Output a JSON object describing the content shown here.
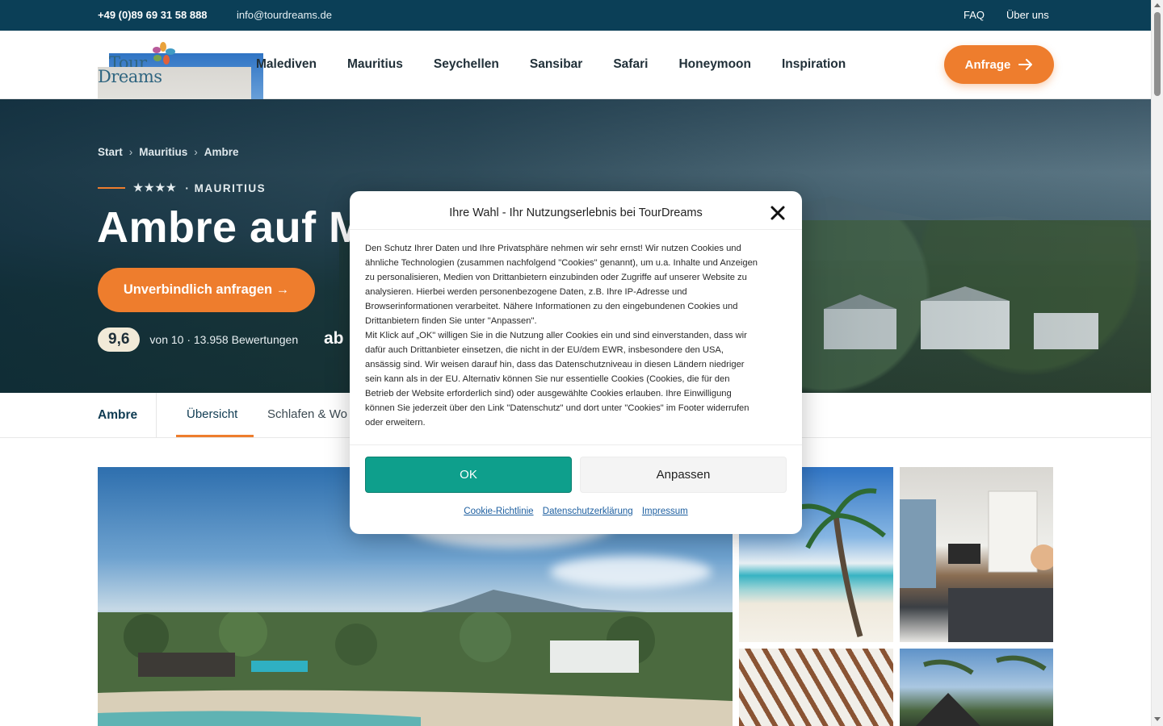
{
  "topbar": {
    "phone": "+49 (0)89 69 31 58 888",
    "email": "info@tourdreams.de",
    "faq": "FAQ",
    "about": "Über uns"
  },
  "logo": {
    "line1": "Tour",
    "line2": "Dreams"
  },
  "nav": {
    "items": [
      "Malediven",
      "Mauritius",
      "Seychellen",
      "Sansibar",
      "Safari",
      "Honeymoon",
      "Inspiration"
    ],
    "cta": "Anfrage"
  },
  "breadcrumb": [
    "Start",
    "Mauritius",
    "Ambre"
  ],
  "hero": {
    "eyebrow_stars": "★★★★",
    "eyebrow_country": "· MAURITIUS",
    "title": "Ambre auf M",
    "cta": "Unverbindlich anfragen →",
    "score": "9,6",
    "reviews": "von 10 · 13.958 Bewertungen",
    "price_prefix": "ab"
  },
  "subnav": {
    "hotel": "Ambre",
    "tabs": [
      "Übersicht",
      "Schlafen & Wo"
    ]
  },
  "cookie": {
    "title": "Ihre Wahl - Ihr Nutzungserlebnis bei TourDreams",
    "paragraph1": "Den Schutz Ihrer Daten und Ihre Privatsphäre nehmen wir sehr ernst! Wir nutzen Cookies und ähnliche Technologien (zusammen nachfolgend \"Cookies\" genannt), um u.a. Inhalte und Anzeigen zu personalisieren, Medien von Drittanbietern einzubinden oder Zugriffe auf unserer Website zu analysieren. Hierbei werden personenbezogene Daten, z.B. Ihre IP-Adresse und Browserinformationen verarbeitet. Nähere Informationen zu den eingebundenen Cookies und Drittanbietern finden Sie unter \"Anpassen\".",
    "paragraph2": "Mit Klick auf „OK\" willigen Sie in die Nutzung aller Cookies ein und sind einverstanden, dass wir dafür auch Drittanbieter einsetzen, die nicht in der EU/dem EWR, insbesondere den USA, ansässig sind. Wir weisen darauf hin, dass das Datenschutzniveau in diesen Ländern niedriger sein kann als in der EU. Alternativ können Sie nur essentielle Cookies (Cookies, die für den Betrieb der Website erforderlich sind) oder ausgewählte Cookies erlauben. Ihre Einwilligung können Sie jederzeit über den Link \"Datenschutz\" und dort unter \"Cookies\" im Footer widerrufen oder erweitern.",
    "ok": "OK",
    "customize": "Anpassen",
    "links": [
      "Cookie-Richtlinie",
      "Datenschutzerklärung",
      "Impressum"
    ]
  },
  "colors": {
    "brand_dark": "#0b3f57",
    "accent": "#ee7d2d",
    "ok_green": "#0e9f8c"
  }
}
